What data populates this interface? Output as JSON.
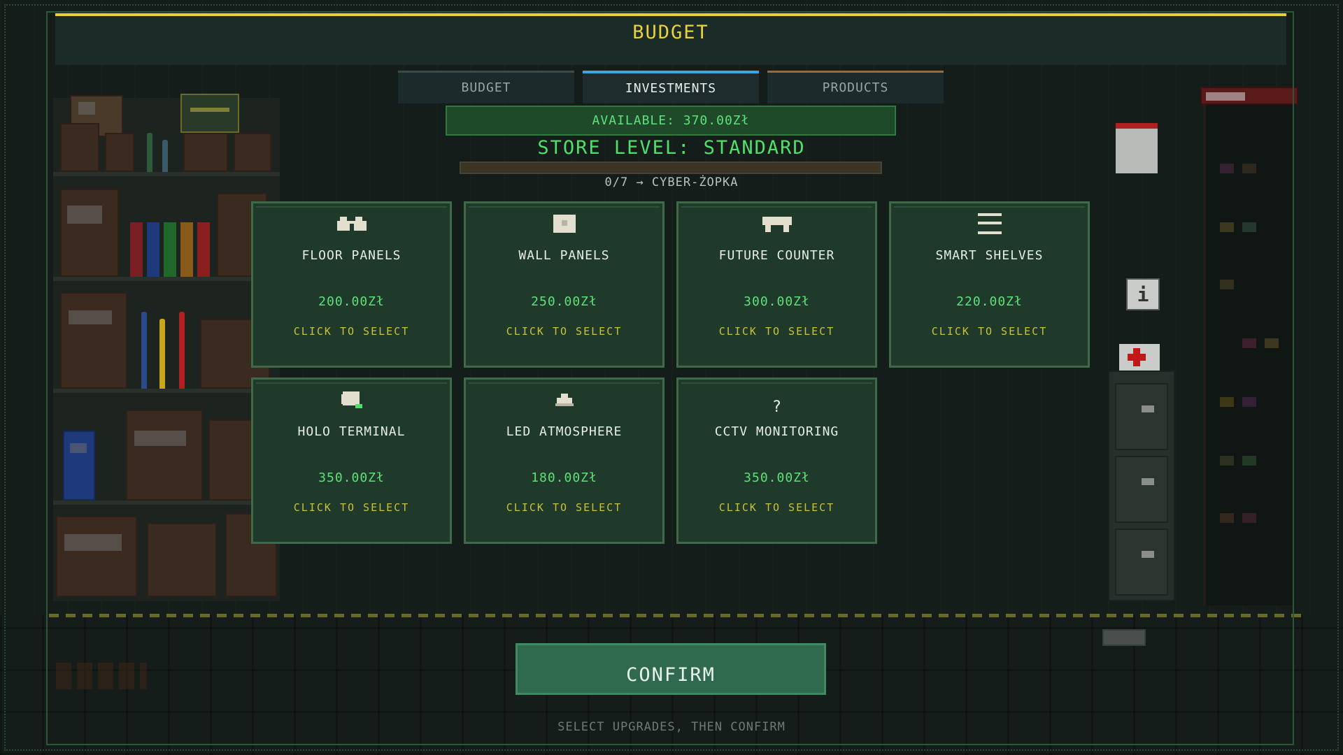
{
  "header": {
    "title": "BUDGET"
  },
  "tabs": [
    {
      "label": "BUDGET",
      "active": false
    },
    {
      "label": "INVESTMENTS",
      "active": true
    },
    {
      "label": "PRODUCTS",
      "active": false
    }
  ],
  "available": "AVAILABLE: 370.00Zł",
  "store_level": "STORE LEVEL: STANDARD",
  "progress": {
    "label": "0/7 → CYBER-ŻOPKA",
    "current": 0,
    "total": 7
  },
  "cards": [
    {
      "name": "FLOOR PANELS",
      "price": "200.00Zł",
      "action": "CLICK TO SELECT",
      "icon": "floor-panels-icon"
    },
    {
      "name": "WALL PANELS",
      "price": "250.00Zł",
      "action": "CLICK TO SELECT",
      "icon": "wall-panels-icon"
    },
    {
      "name": "FUTURE COUNTER",
      "price": "300.00Zł",
      "action": "CLICK TO SELECT",
      "icon": "counter-icon"
    },
    {
      "name": "SMART SHELVES",
      "price": "220.00Zł",
      "action": "CLICK TO SELECT",
      "icon": "shelves-icon"
    },
    {
      "name": "HOLO TERMINAL",
      "price": "350.00Zł",
      "action": "CLICK TO SELECT",
      "icon": "terminal-icon"
    },
    {
      "name": "LED ATMOSPHERE",
      "price": "180.00Zł",
      "action": "CLICK TO SELECT",
      "icon": "led-lamp-icon"
    },
    {
      "name": "CCTV MONITORING",
      "price": "350.00Zł",
      "action": "CLICK TO SELECT",
      "icon": "question-mark-icon",
      "glyph": "?"
    }
  ],
  "confirm_label": "CONFIRM",
  "hint": "SELECT UPGRADES, THEN CONFIRM",
  "colors": {
    "header_accent": "#e7d42f",
    "available_text": "#5fe07a",
    "card_bg": "#1f3a2a",
    "confirm_bg": "#2f6a4e",
    "tab_active": "#3aa6e6"
  }
}
